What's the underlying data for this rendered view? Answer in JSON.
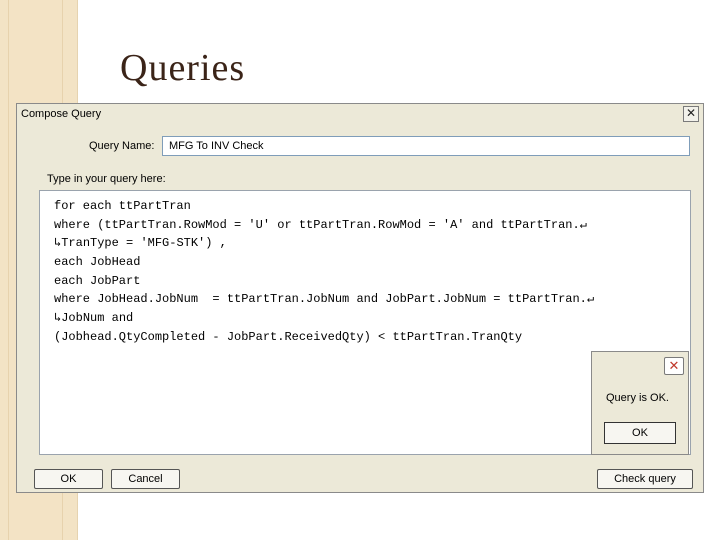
{
  "slide": {
    "title": "Queries"
  },
  "dialog": {
    "title": "Compose Query",
    "close_glyph": "✕",
    "query_name_label": "Query Name:",
    "query_name_value": "MFG To INV Check",
    "type_label": "Type in your query here:",
    "code_lines": [
      "for each ttPartTran",
      "where (ttPartTran.RowMod = 'U' or ttPartTran.RowMod = 'A' and ttPartTran.↵",
      "↳TranType = 'MFG-STK') ,",
      "each JobHead",
      "each JobPart",
      "where JobHead.JobNum  = ttPartTran.JobNum and JobPart.JobNum = ttPartTran.↵",
      "↳JobNum and",
      "(Jobhead.QtyCompleted - JobPart.ReceivedQty) < ttPartTran.TranQty"
    ],
    "buttons": {
      "ok": "OK",
      "cancel": "Cancel",
      "check_query": "Check query"
    }
  },
  "message_box": {
    "text": "Query is OK.",
    "ok_button": "OK",
    "close_glyph": "✕",
    "close_color": "#c0392b"
  }
}
